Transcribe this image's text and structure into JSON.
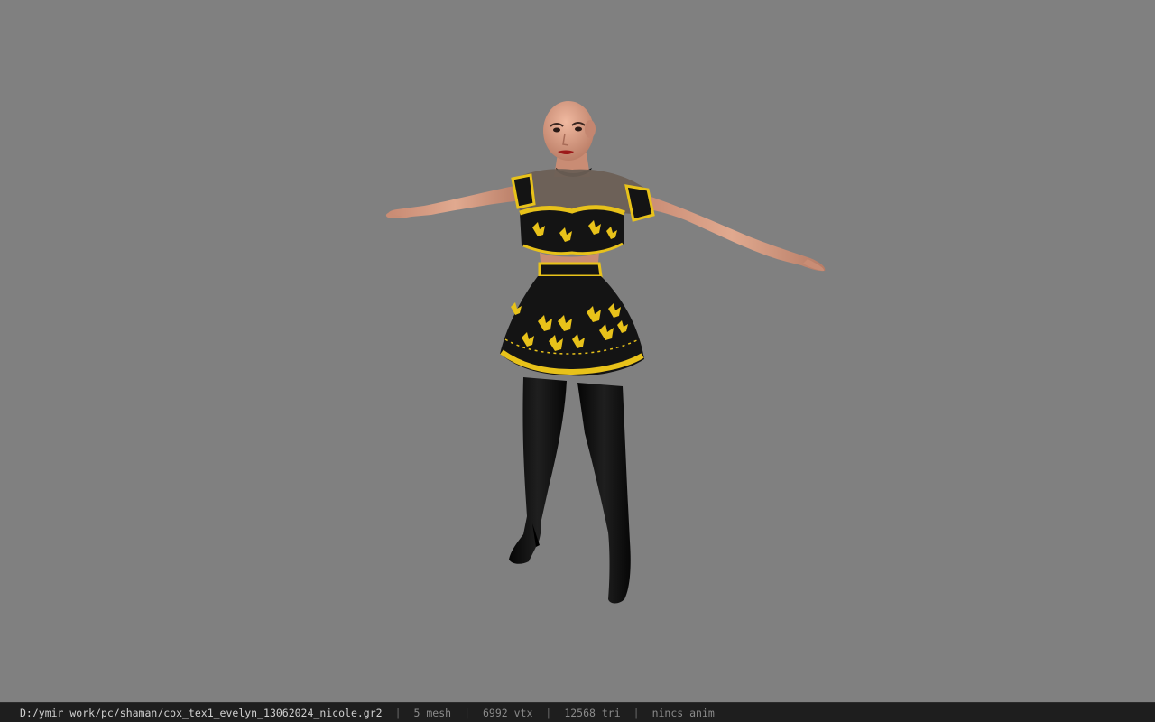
{
  "status_bar": {
    "file_path": "D:/ymir work/pc/shaman/cox_tex1_evelyn_13062024_nicole.gr2",
    "separator": "|",
    "mesh": "5 mesh",
    "vtx": "6992 vtx",
    "tri": "12568 tri",
    "anim": "nincs anim"
  },
  "viewport": {
    "background_color": "#808080",
    "model": "female-character-t-pose"
  },
  "colors": {
    "skin": "#d49a82",
    "outfit_black": "#141414",
    "trim_gold": "#e8c21a",
    "mesh_top": "#6b5f55"
  }
}
